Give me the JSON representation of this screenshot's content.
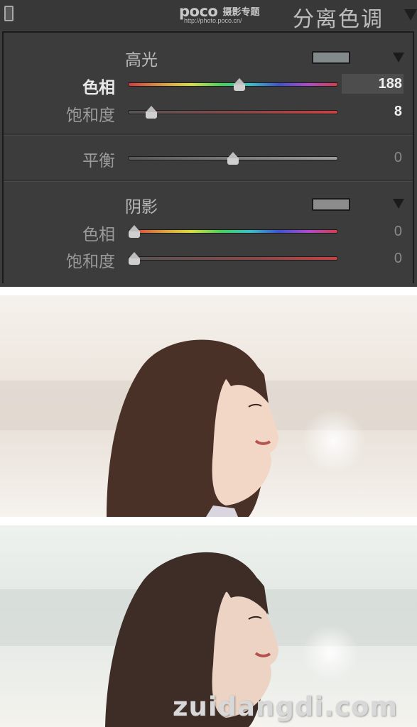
{
  "header": {
    "logo_text": "poco",
    "logo_subtitle": "摄影专题",
    "logo_url": "http://photo.poco.cn/",
    "panel_title": "分离色调"
  },
  "highlights": {
    "section_label": "高光",
    "swatch_color": "#828a8b",
    "hue": {
      "label": "色相",
      "value": "188",
      "fraction": 0.53
    },
    "saturation": {
      "label": "饱和度",
      "value": "8",
      "fraction": 0.11
    }
  },
  "balance": {
    "label": "平衡",
    "value": "0",
    "fraction": 0.5
  },
  "shadows": {
    "section_label": "阴影",
    "swatch_color": "#8c8c8c",
    "hue": {
      "label": "色相",
      "value": "0",
      "fraction": 0.03
    },
    "saturation": {
      "label": "饱和度",
      "value": "0",
      "fraction": 0.03
    }
  },
  "watermark": "zuidangdi.com",
  "photos": {
    "before_background": "#f4f0ec",
    "after_background": "#eef1ee"
  }
}
